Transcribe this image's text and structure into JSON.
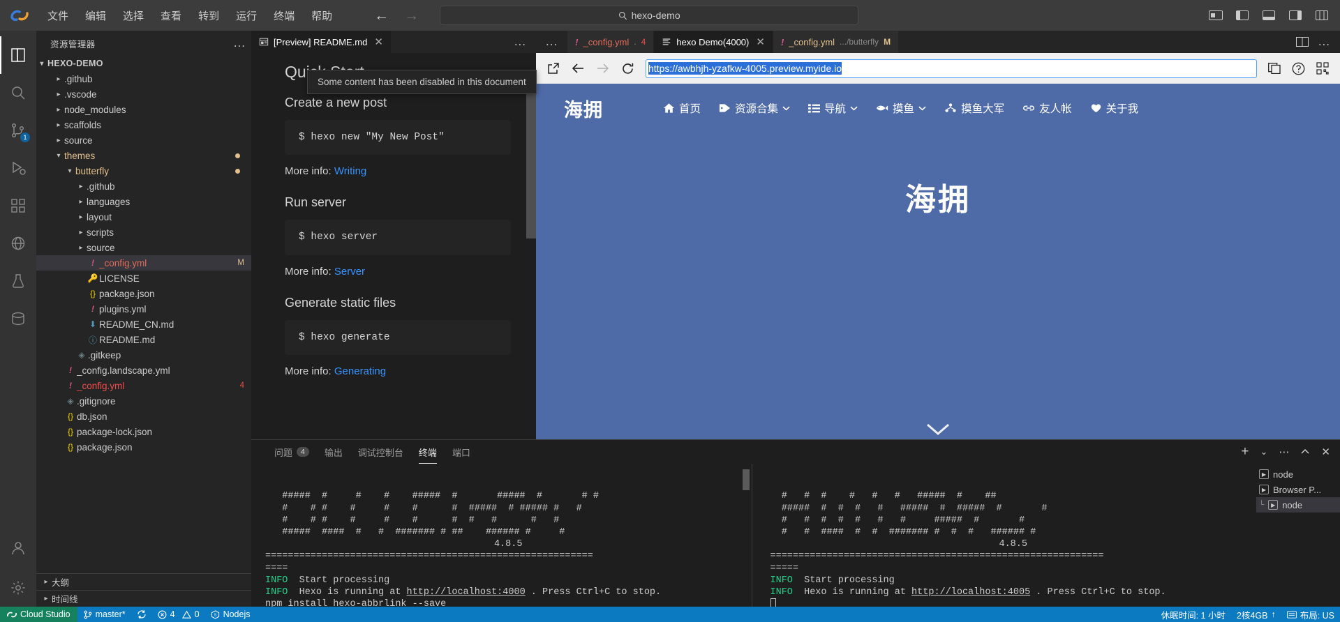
{
  "titlebar": {
    "menu": [
      "文件",
      "编辑",
      "选择",
      "查看",
      "转到",
      "运行",
      "终端",
      "帮助"
    ],
    "back_arrow": "←",
    "forward_arrow": "→",
    "search_value": "hexo-demo"
  },
  "activitybar": {
    "items": [
      {
        "name": "explorer",
        "badge": ""
      },
      {
        "name": "search",
        "badge": ""
      },
      {
        "name": "source-control",
        "badge": "1"
      },
      {
        "name": "run-debug",
        "badge": ""
      },
      {
        "name": "extensions",
        "badge": ""
      },
      {
        "name": "remote",
        "badge": ""
      },
      {
        "name": "test",
        "badge": ""
      },
      {
        "name": "docker",
        "badge": ""
      }
    ]
  },
  "sidebar": {
    "title": "资源管理器",
    "more_label": "...",
    "root": "HEXO-DEMO",
    "tree": [
      {
        "label": ".github",
        "indent": 1,
        "type": "folder",
        "open": false
      },
      {
        "label": ".vscode",
        "indent": 1,
        "type": "folder",
        "open": false
      },
      {
        "label": "node_modules",
        "indent": 1,
        "type": "folder",
        "open": false
      },
      {
        "label": "scaffolds",
        "indent": 1,
        "type": "folder",
        "open": false
      },
      {
        "label": "source",
        "indent": 1,
        "type": "folder",
        "open": false
      },
      {
        "label": "themes",
        "indent": 1,
        "type": "folder",
        "open": true,
        "color": "mod",
        "dot": true
      },
      {
        "label": "butterfly",
        "indent": 2,
        "type": "folder",
        "open": true,
        "color": "mod",
        "dot": true
      },
      {
        "label": ".github",
        "indent": 3,
        "type": "folder",
        "open": false
      },
      {
        "label": "languages",
        "indent": 3,
        "type": "folder",
        "open": false
      },
      {
        "label": "layout",
        "indent": 3,
        "type": "folder",
        "open": false
      },
      {
        "label": "scripts",
        "indent": 3,
        "type": "folder",
        "open": false
      },
      {
        "label": "source",
        "indent": 3,
        "type": "folder",
        "open": false
      },
      {
        "label": "_config.yml",
        "indent": 3,
        "type": "yml",
        "color": "yml",
        "selected": true,
        "badge": "M",
        "badgeColor": "#e2c08d"
      },
      {
        "label": "LICENSE",
        "indent": 3,
        "type": "key"
      },
      {
        "label": "package.json",
        "indent": 3,
        "type": "json"
      },
      {
        "label": "plugins.yml",
        "indent": 3,
        "type": "yml"
      },
      {
        "label": "README_CN.md",
        "indent": 3,
        "type": "mddown"
      },
      {
        "label": "README.md",
        "indent": 3,
        "type": "mdinfo"
      },
      {
        "label": ".gitkeep",
        "indent": 2,
        "type": "gitdiamond"
      },
      {
        "label": "_config.landscape.yml",
        "indent": 1,
        "type": "yml"
      },
      {
        "label": "_config.yml",
        "indent": 1,
        "type": "yml",
        "color": "red",
        "badge": "4",
        "badgeColor": "#f14c4c"
      },
      {
        "label": ".gitignore",
        "indent": 1,
        "type": "gitdiamond"
      },
      {
        "label": "db.json",
        "indent": 1,
        "type": "json"
      },
      {
        "label": "package-lock.json",
        "indent": 1,
        "type": "json"
      },
      {
        "label": "package.json",
        "indent": 1,
        "type": "json"
      }
    ],
    "panels": [
      {
        "label": "大纲"
      },
      {
        "label": "时间线"
      }
    ]
  },
  "editor_left": {
    "more_label": "...",
    "tab": {
      "label": "[Preview] README.md",
      "close": "✕"
    },
    "notification": "Some content has been disabled in this document",
    "preview": {
      "h2": "Quick Start",
      "h3_create": "Create a new post",
      "code_new": "$ hexo new \"My New Post\"",
      "more_writing_prefix": "More info: ",
      "more_writing_link": "Writing",
      "h3_run": "Run server",
      "code_server": "$ hexo server",
      "more_server_prefix": "More info: ",
      "more_server_link": "Server",
      "h3_gen": "Generate static files",
      "code_generate": "$ hexo generate",
      "more_gen_prefix": "More info: ",
      "more_gen_link": "Generating"
    }
  },
  "editor_right": {
    "more_label": "...",
    "tabs": [
      {
        "label": "_config.yml",
        "desc": ".",
        "error": "4",
        "icon": "yml",
        "active": false
      },
      {
        "label": "hexo Demo(4000)",
        "icon": "preview",
        "active": true,
        "close": "✕"
      },
      {
        "label": "_config.yml",
        "desc": ".../butterfly",
        "modified": "M",
        "icon": "yml",
        "active": false
      }
    ],
    "split_label": "split-editor",
    "more_actions_label": "..."
  },
  "browser": {
    "open_external_label": "open-external",
    "back_label": "←",
    "forward_label": "→",
    "reload_label": "⟳",
    "url": "https://awbhjh-yzafkw-4005.preview.myide.io",
    "devtools_label": "devtools",
    "help_label": "?",
    "qr_label": "qr"
  },
  "site": {
    "logo": "海拥",
    "menu": [
      {
        "icon": "home-icon",
        "label": "首页",
        "caret": false
      },
      {
        "icon": "tag-icon",
        "label": "资源合集",
        "caret": true
      },
      {
        "icon": "list-icon",
        "label": "导航",
        "caret": true
      },
      {
        "icon": "fish-icon",
        "label": "摸鱼",
        "caret": true
      },
      {
        "icon": "group-icon",
        "label": "摸鱼大军",
        "caret": false
      },
      {
        "icon": "link-icon",
        "label": "友人帐",
        "caret": false
      },
      {
        "icon": "heart-icon",
        "label": "关于我",
        "caret": false
      }
    ],
    "hero": "海拥",
    "bg_color": "#4e6ba8"
  },
  "panel": {
    "tabs": [
      {
        "label": "问题",
        "badge": "4",
        "active": false
      },
      {
        "label": "输出",
        "badge": "",
        "active": false
      },
      {
        "label": "调试控制台",
        "badge": "",
        "active": false
      },
      {
        "label": "终端",
        "badge": "",
        "active": true
      },
      {
        "label": "端口",
        "badge": "",
        "active": false
      }
    ],
    "actions": {
      "add": "+",
      "chevron": "⌄",
      "more": "⋯",
      "maximize": "⌃",
      "minimize": "⌄",
      "close": "✕"
    },
    "terminal_left": {
      "ascii": [
        "   #####  #     #    #    #####  #       #####  #       # #",
        "   #    # #    #     #    #      #  #####  # ##### #   #",
        "   #    # #    #     #    #      #  #   #      #   #",
        "   #####  ####  #   #  ####### # ##    ###### #     #"
      ],
      "version": "4.8.5",
      "separator": "==========================================================",
      "sep_tail": "====",
      "lines": [
        {
          "tag": "INFO",
          "text": "Start processing"
        },
        {
          "tag": "INFO",
          "text": "Hexo is running at ",
          "link": "http://localhost:4000",
          "tail": " . Press Ctrl+C to stop."
        },
        {
          "tag": "",
          "text": "npm install hexo-abbrlink --save"
        }
      ]
    },
    "terminal_right": {
      "ascii": [
        "  #   #  #    #   #   #   #####  #    ##",
        "  #####  #  #  #   #   #####  #  #####  #       #",
        "  #   #  #  #  #   #   #     #####  #       #",
        "  #   #  ####  #  #  ####### #  #  #   ###### #"
      ],
      "version": "4.8.5",
      "separator": "===========================================================",
      "sep_tail": "=====",
      "lines": [
        {
          "tag": "INFO",
          "text": "Start processing"
        },
        {
          "tag": "INFO",
          "text": "Hexo is running at ",
          "link": "http://localhost:4005",
          "tail": " . Press Ctrl+C to stop."
        }
      ]
    },
    "terminal_list": [
      {
        "label": "node",
        "prefix": "",
        "active": false
      },
      {
        "label": "Browser P...",
        "prefix": "",
        "active": false
      },
      {
        "label": "node",
        "prefix": "└",
        "active": true
      }
    ]
  },
  "statusbar": {
    "brand": "Cloud Studio",
    "branch": "master*",
    "sync_label": "sync-icon",
    "errors": "4",
    "warnings": "0",
    "runtime": "Nodejs",
    "right": [
      {
        "label": "休眠时间: 1 小时",
        "icon": ""
      },
      {
        "label": "2核4GB",
        "icon": "up-arrow"
      },
      {
        "label": "布局: US",
        "icon": "layout"
      }
    ]
  }
}
